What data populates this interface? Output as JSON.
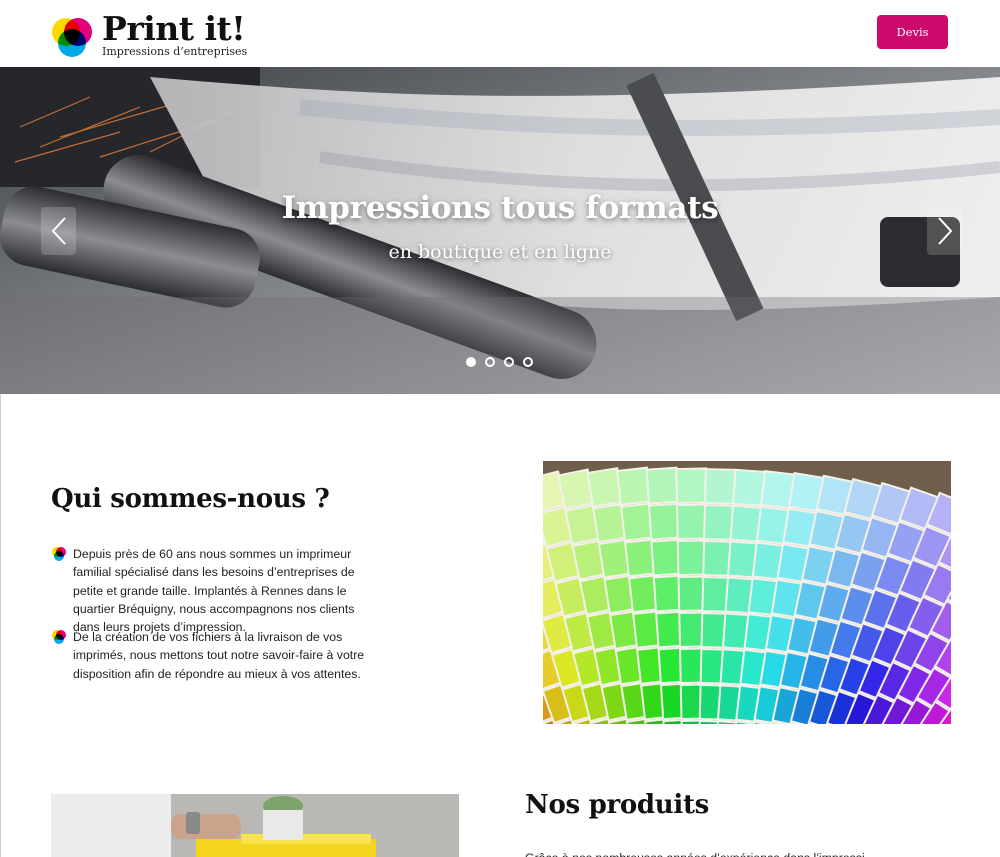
{
  "header": {
    "logo_title": "Print it!",
    "logo_subtitle": "Impressions d’entreprises",
    "devis_label": "Devis"
  },
  "hero": {
    "title": "Impressions tous formats",
    "subtitle": "en boutique et en ligne",
    "slide_count": 4,
    "active_slide": 1
  },
  "about": {
    "title": "Qui sommes-nous ?",
    "paragraphs": [
      "Depuis près de 60 ans nous sommes un imprimeur familial spécialisé dans les besoins d’entreprises de petite et grande taille. Implantés à Rennes dans le quartier Bréquigny, nous accompagnons nos clients dans leurs projets d’impression.",
      "De la création de vos fichiers à la livraison de vos imprimés, nous mettons tout notre savoir-faire à votre disposition afin de répondre au mieux à vos attentes."
    ]
  },
  "products": {
    "title": "Nos produits",
    "intro": "Grâce à nos nombreuses années d’expérience dans l’impression de"
  },
  "colors": {
    "brand": "#cc0a6c",
    "cyan": "#00a8e8",
    "magenta": "#e4007c",
    "yellow": "#ffd800"
  },
  "icons": {
    "logo": "cmyk-circles-icon",
    "bullet": "cmyk-circles-icon",
    "prev": "chevron-left-icon",
    "next": "chevron-right-icon"
  }
}
